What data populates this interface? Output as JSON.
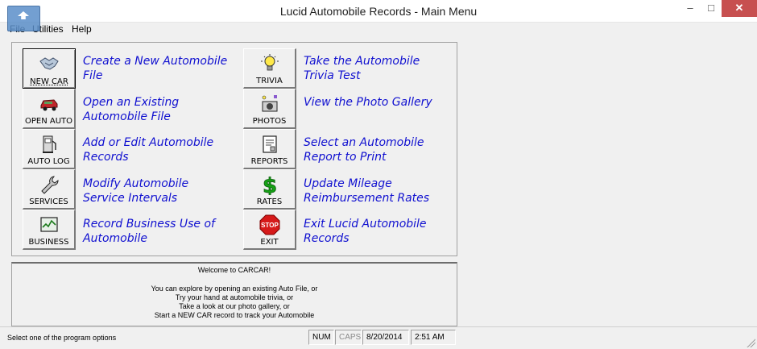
{
  "window": {
    "title": "Lucid Automobile Records - Main Menu",
    "minimize": "–",
    "maximize": "□",
    "close": "✕"
  },
  "menu": {
    "file": "File",
    "utilities": "Utilities",
    "help": "Help"
  },
  "left_buttons": [
    {
      "label": "NEW CAR",
      "icon": "handshake-icon",
      "desc": "Create a New Automobile File"
    },
    {
      "label": "OPEN AUTO",
      "icon": "car-icon",
      "desc": "Open an Existing Automobile File"
    },
    {
      "label": "AUTO LOG",
      "icon": "fuel-pump-icon",
      "desc": "Add or Edit Automobile Records"
    },
    {
      "label": "SERVICES",
      "icon": "wrench-icon",
      "desc": "Modify Automobile Service Intervals"
    },
    {
      "label": "BUSINESS",
      "icon": "chart-monitor-icon",
      "desc": "Record Business Use of Automobile"
    }
  ],
  "right_buttons": [
    {
      "label": "TRIVIA",
      "icon": "lightbulb-icon",
      "desc": "Take the Automobile Trivia Test"
    },
    {
      "label": "PHOTOS",
      "icon": "camera-icon",
      "desc": "View the Photo Gallery"
    },
    {
      "label": "REPORTS",
      "icon": "report-icon",
      "desc": "Select an Automobile Report to Print"
    },
    {
      "label": "RATES",
      "icon": "dollar-icon",
      "desc": "Update Mileage Reimbursement Rates"
    },
    {
      "label": "EXIT",
      "icon": "stop-sign-icon",
      "desc": "Exit  Lucid Automobile Records",
      "stop_text": "STOP"
    }
  ],
  "message": {
    "welcome": "Welcome to CARCAR!",
    "lines": [
      "You can explore by opening an existing Auto File, or",
      "Try your hand at automobile trivia, or",
      "Take a look at our photo gallery, or",
      "Start a NEW CAR record to track your Automobile"
    ]
  },
  "status": {
    "message": "Select one of the program options",
    "num": "NUM",
    "caps": "CAPS",
    "date": "8/20/2014",
    "time": "2:51 AM"
  },
  "colors": {
    "link_text": "#1010d0",
    "close_button": "#c75050"
  }
}
